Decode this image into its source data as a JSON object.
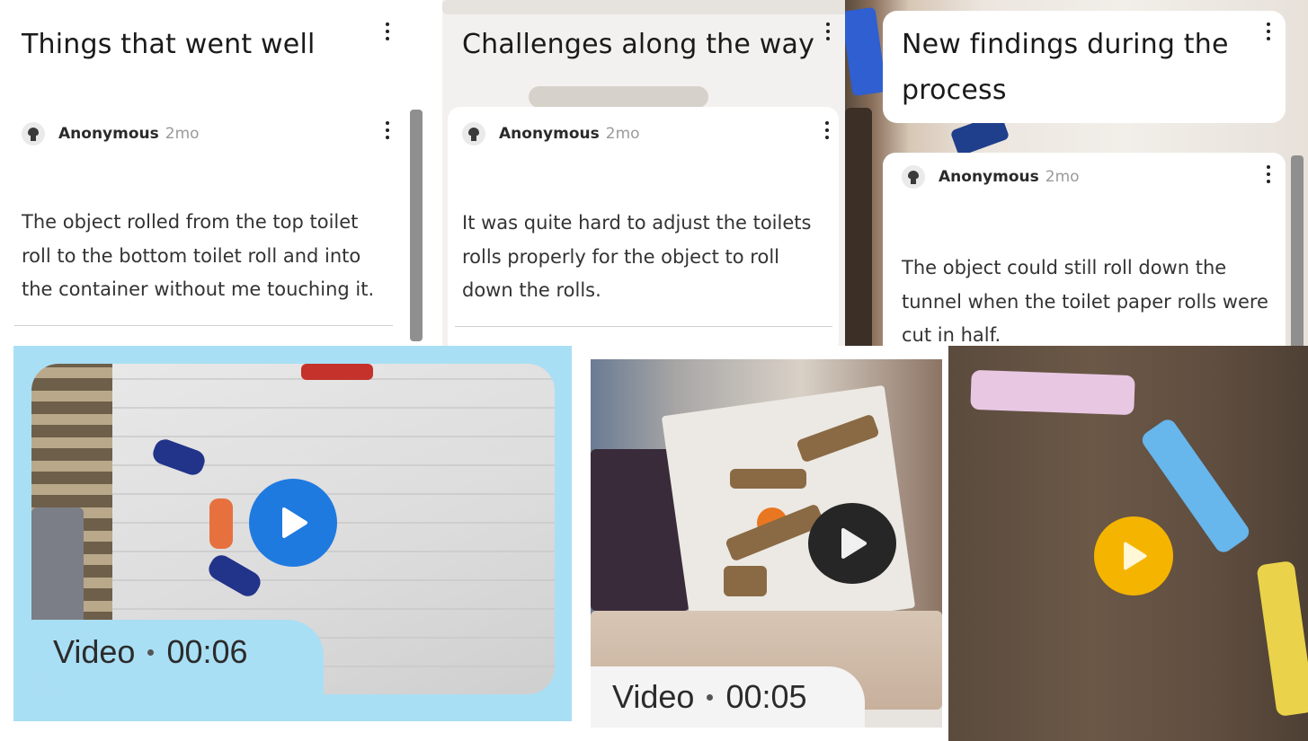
{
  "columns": [
    {
      "title": "Things that went well",
      "post": {
        "author": "Anonymous",
        "age": "2mo",
        "body": "The object rolled from the top toilet roll to the bottom toilet roll and into the container without me touching it."
      }
    },
    {
      "title": "Challenges along the way",
      "post": {
        "author": "Anonymous",
        "age": "2mo",
        "body": "It was quite hard to adjust the toilets rolls properly for the object to roll down the rolls."
      }
    },
    {
      "title": "New findings during the process",
      "post": {
        "author": "Anonymous",
        "age": "2mo",
        "body": "The object could still roll down the tunnel when the toilet paper rolls were cut in half."
      }
    }
  ],
  "videos": [
    {
      "type_label": "Video",
      "duration": "00:06",
      "play_color": "#1f7ae0"
    },
    {
      "type_label": "Video",
      "duration": "00:05",
      "play_color": "#2b2b2b"
    },
    {
      "type_label": "",
      "duration": "",
      "play_color": "#f5b400"
    }
  ],
  "icons": {
    "avatar": "anonymous-avatar-icon",
    "menu": "more-vertical-icon",
    "play": "play-icon"
  }
}
